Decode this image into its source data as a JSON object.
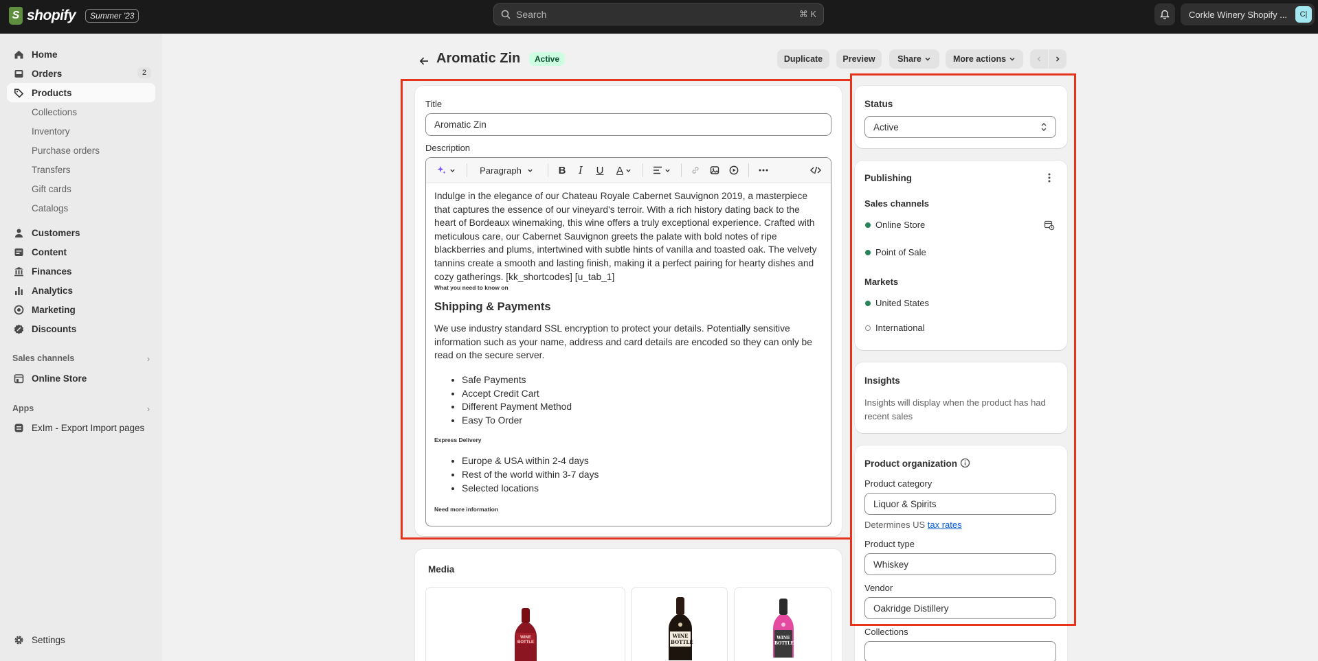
{
  "topbar": {
    "logo_text": "shopify",
    "logo_glyph": "S",
    "edition": "Summer '23",
    "search_placeholder": "Search",
    "search_shortcut": "⌘ K",
    "store_name": "Corkle Winery Shopify ...",
    "store_initials": "C|"
  },
  "sidebar": {
    "main_items": [
      {
        "label": "Home",
        "icon": "home-icon"
      },
      {
        "label": "Orders",
        "icon": "inbox-icon",
        "badge": "2"
      },
      {
        "label": "Products",
        "icon": "tag-icon"
      }
    ],
    "product_subitems": [
      "Collections",
      "Inventory",
      "Purchase orders",
      "Transfers",
      "Gift cards",
      "Catalogs"
    ],
    "other_items": [
      {
        "label": "Customers",
        "icon": "person-icon"
      },
      {
        "label": "Content",
        "icon": "content-icon"
      },
      {
        "label": "Finances",
        "icon": "bank-icon"
      },
      {
        "label": "Analytics",
        "icon": "bar-chart-icon"
      },
      {
        "label": "Marketing",
        "icon": "target-icon"
      },
      {
        "label": "Discounts",
        "icon": "discount-icon"
      }
    ],
    "sales_channels_heading": "Sales channels",
    "online_store": "Online Store",
    "apps_heading": "Apps",
    "app_item": "ExIm - Export Import pages",
    "settings": "Settings"
  },
  "header": {
    "title": "Aromatic Zin",
    "status_badge": "Active",
    "duplicate": "Duplicate",
    "preview": "Preview",
    "share": "Share",
    "more_actions": "More actions"
  },
  "product": {
    "title_label": "Title",
    "title_value": "Aromatic Zin",
    "description_label": "Description",
    "paragraph_style": "Paragraph",
    "description_intro": "Indulge in the elegance of our Chateau Royale Cabernet Sauvignon 2019, a masterpiece that captures the essence of our vineyard's terroir. With a rich history dating back to the heart of Bordeaux winemaking, this wine offers a truly exceptional experience. Crafted with meticulous care, our Cabernet Sauvignon greets the palate with bold notes of ripe blackberries and plums, intertwined with subtle hints of vanilla and toasted oak. The velvety tannins create a smooth and lasting finish, making it a perfect pairing for hearty dishes and cozy gatherings. [kk_shortcodes] [u_tab_1]",
    "know_on": "What you need to know on",
    "shipping_heading": "Shipping & Payments",
    "ssl_text": "We use industry standard SSL encryption to protect your details. Potentially sensitive information such as your name, address and card details are encoded so they can only be read on the secure server.",
    "payment_list": [
      "Safe Payments",
      "Accept Credit Cart",
      "Different Payment Method",
      "Easy To Order"
    ],
    "express_heading": "Express Delivery",
    "delivery_list": [
      "Europe & USA within 2-4 days",
      "Rest of the world within 3-7 days",
      "Selected locations"
    ],
    "need_more": "Need more information"
  },
  "media": {
    "heading": "Media",
    "bottle_label": "WINE BOTTLE"
  },
  "status_card": {
    "heading": "Status",
    "value": "Active"
  },
  "publishing": {
    "heading": "Publishing",
    "sales_channels": "Sales channels",
    "channels": [
      "Online Store",
      "Point of Sale"
    ],
    "markets_heading": "Markets",
    "markets": [
      "United States",
      "International"
    ]
  },
  "insights": {
    "heading": "Insights",
    "text": "Insights will display when the product has had recent sales"
  },
  "organization": {
    "heading": "Product organization",
    "category_label": "Product category",
    "category_value": "Liquor & Spirits",
    "tax_prefix": "Determines US",
    "tax_link": "tax rates",
    "type_label": "Product type",
    "type_value": "Whiskey",
    "vendor_label": "Vendor",
    "vendor_value": "Oakridge Distillery",
    "collections_label": "Collections"
  },
  "colors": {
    "topbar": "#1a1a1a",
    "active_badge_bg": "#cdfee1",
    "green_dot": "#29845a",
    "highlight_red": "#e8331c",
    "link": "#005bd3"
  }
}
